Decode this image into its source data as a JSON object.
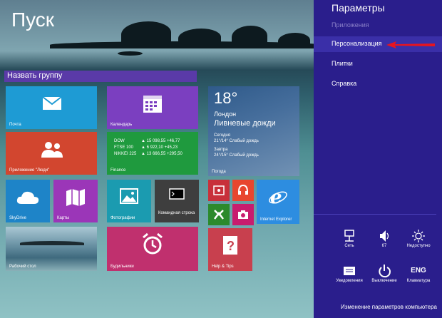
{
  "start": {
    "title": "Пуск",
    "group_name": "Назвать группу"
  },
  "tiles": {
    "mail": "Почта",
    "calendar": "Календарь",
    "people": "Приложение \"Люди\"",
    "finance": "Finance",
    "finance_rows": [
      {
        "name": "DOW",
        "value": "▲ 15 098,55 +46,77"
      },
      {
        "name": "FTSE 100",
        "value": "▲ 6 922,10 +45,23"
      },
      {
        "name": "NIKKEI 225",
        "value": "▲ 13 666,55 +295,50"
      }
    ],
    "weather": {
      "label": "Погода",
      "temp": "18°",
      "city": "Лондон",
      "condition": "Ливневые дожди",
      "today": "Сегодня",
      "today_forecast": "21°/14° Слабый дождь",
      "tomorrow": "Завтра",
      "tomorrow_forecast": "24°/15° Слабый дождь"
    },
    "skydrive": "SkyDrive",
    "maps": "Карты",
    "photos": "Фотографии",
    "cmd": "Командная строка",
    "ie": "Internet Explorer",
    "desktop": "Рабочий стол",
    "alarms": "Будильники",
    "help": "Help & Tips"
  },
  "settings": {
    "title": "Параметры",
    "apps": "Приложения",
    "items": [
      "Персонализация",
      "Плитки",
      "Справка"
    ],
    "quick": [
      {
        "label": "Сеть",
        "icon": "network-icon"
      },
      {
        "label": "67",
        "icon": "volume-icon"
      },
      {
        "label": "Недоступно",
        "icon": "brightness-icon"
      },
      {
        "label": "Уведомления",
        "icon": "notifications-icon"
      },
      {
        "label": "Выключение",
        "icon": "power-icon"
      },
      {
        "label": "Клавиатура",
        "icon": "keyboard-icon",
        "text": "ENG"
      }
    ],
    "footer": "Изменение параметров компьютера"
  },
  "colors": {
    "panel": "#2a1e8c",
    "accent_arrow": "#e8141e"
  }
}
